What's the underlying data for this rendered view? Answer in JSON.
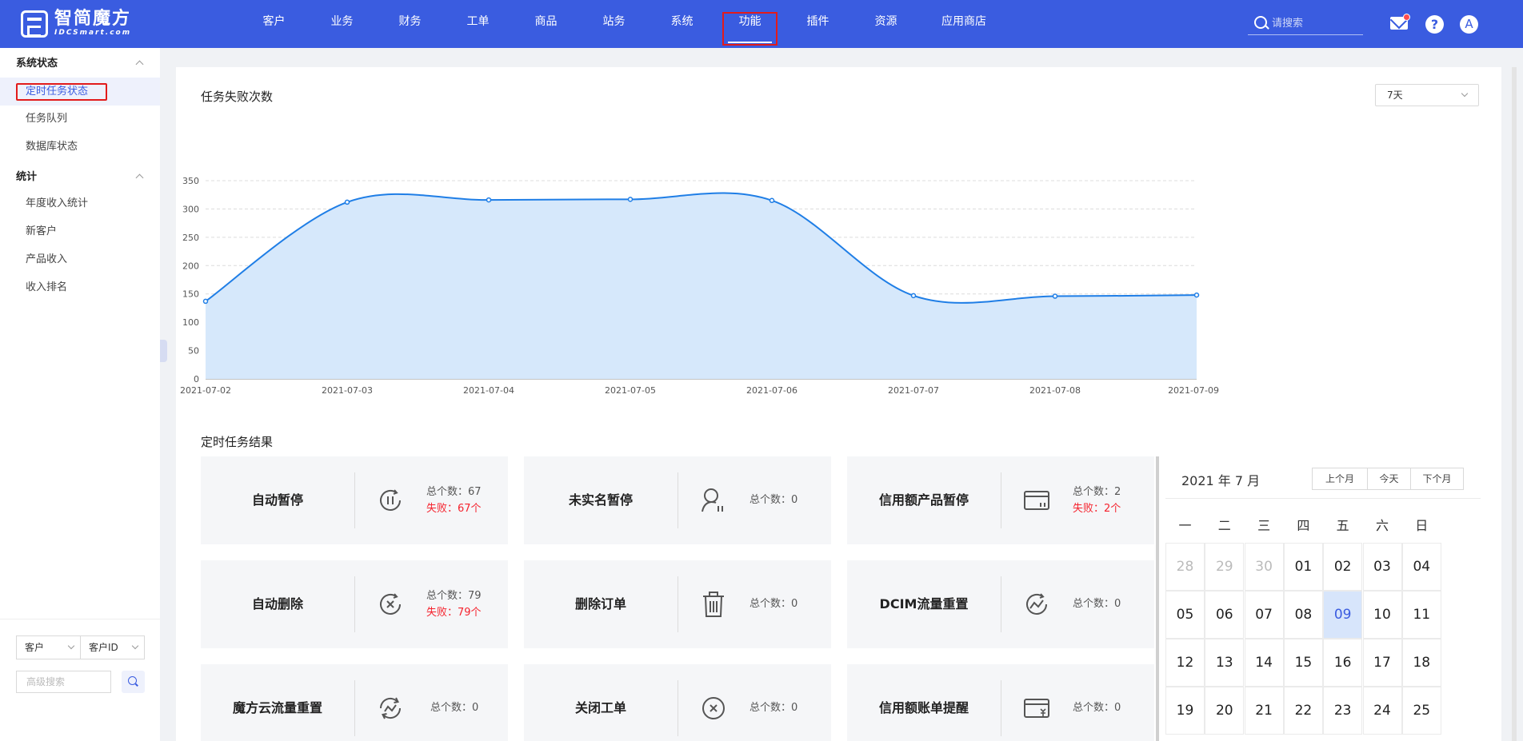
{
  "brand": {
    "name_cn": "智简魔方",
    "name_en": "IDCSmart.com"
  },
  "nav": [
    {
      "label": "客户"
    },
    {
      "label": "业务"
    },
    {
      "label": "财务"
    },
    {
      "label": "工单"
    },
    {
      "label": "商品"
    },
    {
      "label": "站务"
    },
    {
      "label": "系统"
    },
    {
      "label": "功能",
      "active": true
    },
    {
      "label": "插件"
    },
    {
      "label": "资源"
    },
    {
      "label": "应用商店"
    }
  ],
  "search": {
    "placeholder": "请搜索"
  },
  "header_icons": {
    "help": "?",
    "avatar": "A",
    "mail_has_unread": true
  },
  "sidebar": {
    "groups": [
      {
        "label": "系统状态",
        "items": [
          {
            "label": "定时任务状态",
            "active": true
          },
          {
            "label": "任务队列"
          },
          {
            "label": "数据库状态"
          }
        ]
      },
      {
        "label": "统计",
        "items": [
          {
            "label": "年度收入统计"
          },
          {
            "label": "新客户"
          },
          {
            "label": "产品收入"
          },
          {
            "label": "收入排名"
          }
        ]
      }
    ],
    "filter": {
      "type": "客户",
      "field": "客户ID",
      "advanced_placeholder": "高级搜索"
    }
  },
  "main": {
    "chart_title": "任务失败次数",
    "range": "7天",
    "results_title": "定时任务结果"
  },
  "chart_data": {
    "type": "area",
    "title": "任务失败次数",
    "x": [
      "2021-07-02",
      "2021-07-03",
      "2021-07-04",
      "2021-07-05",
      "2021-07-06",
      "2021-07-07",
      "2021-07-08",
      "2021-07-09"
    ],
    "series": [
      {
        "values": [
          137,
          312,
          316,
          317,
          315,
          147,
          146,
          148
        ]
      }
    ],
    "ylim": [
      0,
      350
    ],
    "yticks": [
      0,
      50,
      100,
      150,
      200,
      250,
      300,
      350
    ],
    "grid": true,
    "colors": {
      "line": "#1f7ee6",
      "fill": "#d6e8fb"
    }
  },
  "tasks": [
    {
      "name": "自动暂停",
      "total_label": "总个数：67",
      "fail_label": "失败：67个",
      "icon": "pause-circle-icon"
    },
    {
      "name": "未实名暂停",
      "total_label": "总个数：0",
      "fail_label": "",
      "icon": "user-pause-icon"
    },
    {
      "name": "信用额产品暂停",
      "total_label": "总个数：2",
      "fail_label": "失败：2个",
      "icon": "credit-card-icon"
    },
    {
      "name": "自动删除",
      "total_label": "总个数：79",
      "fail_label": "失败：79个",
      "icon": "cross-circle-icon"
    },
    {
      "name": "删除订单",
      "total_label": "总个数：0",
      "fail_label": "",
      "icon": "trash-icon"
    },
    {
      "name": "DCIM流量重置",
      "total_label": "总个数：0",
      "fail_label": "",
      "icon": "traffic-reset-icon"
    },
    {
      "name": "魔方云流量重置",
      "total_label": "总个数：0",
      "fail_label": "",
      "icon": "cloud-traffic-reset-icon"
    },
    {
      "name": "关闭工单",
      "total_label": "总个数：0",
      "fail_label": "",
      "icon": "close-circle-icon"
    },
    {
      "name": "信用额账单提醒",
      "total_label": "总个数：0",
      "fail_label": "",
      "icon": "credit-bill-icon"
    }
  ],
  "calendar": {
    "title": "2021 年 7 月",
    "buttons": [
      "上个月",
      "今天",
      "下个月"
    ],
    "weekdays": [
      "一",
      "二",
      "三",
      "四",
      "五",
      "六",
      "日"
    ],
    "days": [
      "28",
      "29",
      "30",
      "01",
      "02",
      "03",
      "04",
      "05",
      "06",
      "07",
      "08",
      "09",
      "10",
      "11",
      "12",
      "13",
      "14",
      "15",
      "16",
      "17",
      "18",
      "19",
      "20",
      "21",
      "22",
      "23",
      "24",
      "25"
    ],
    "prev_month_days": 3,
    "today": "09"
  }
}
